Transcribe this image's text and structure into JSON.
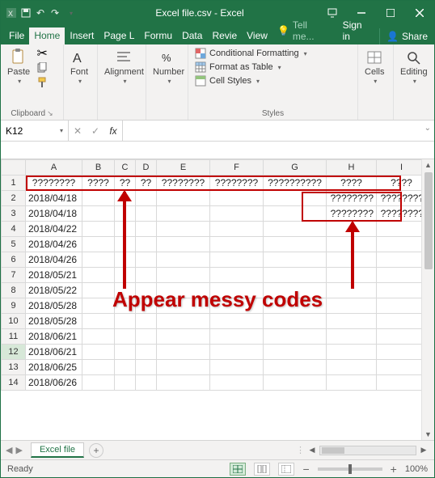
{
  "title": "Excel file.csv - Excel",
  "menu": {
    "file": "File",
    "home": "Home",
    "insert": "Insert",
    "page": "Page L",
    "formulas": "Formu",
    "data": "Data",
    "review": "Revie",
    "view": "View",
    "tell": "Tell me...",
    "signin": "Sign in",
    "share": "Share"
  },
  "ribbon": {
    "clipboard": {
      "paste": "Paste",
      "label": "Clipboard"
    },
    "font": {
      "btn": "Font",
      "label": ""
    },
    "alignment": {
      "btn": "Alignment",
      "label": ""
    },
    "number": {
      "btn": "Number",
      "label": ""
    },
    "styles": {
      "cond": "Conditional Formatting",
      "table": "Format as Table",
      "cell": "Cell Styles",
      "label": "Styles"
    },
    "cells": {
      "btn": "Cells",
      "label": ""
    },
    "editing": {
      "btn": "Editing",
      "label": ""
    }
  },
  "namebox": "K12",
  "columns": [
    "A",
    "B",
    "C",
    "D",
    "E",
    "F",
    "G",
    "H",
    "I"
  ],
  "rows": [
    {
      "n": 1,
      "A": "????????",
      "B": "????",
      "C": "??",
      "D": "??",
      "E": "????????",
      "F": "????????",
      "G": "??????????",
      "H": "????",
      "I": "????"
    },
    {
      "n": 2,
      "A": "2018/04/18",
      "H": "????????",
      "I": "????????"
    },
    {
      "n": 3,
      "A": "2018/04/18",
      "H": "????????",
      "I": "????????"
    },
    {
      "n": 4,
      "A": "2018/04/22"
    },
    {
      "n": 5,
      "A": "2018/04/26"
    },
    {
      "n": 6,
      "A": "2018/04/26"
    },
    {
      "n": 7,
      "A": "2018/05/21"
    },
    {
      "n": 8,
      "A": "2018/05/22"
    },
    {
      "n": 9,
      "A": "2018/05/28"
    },
    {
      "n": 10,
      "A": "2018/05/28"
    },
    {
      "n": 11,
      "A": "2018/06/21"
    },
    {
      "n": 12,
      "A": "2018/06/21",
      "sel": true
    },
    {
      "n": 13,
      "A": "2018/06/25"
    },
    {
      "n": 14,
      "A": "2018/06/26"
    }
  ],
  "sheet_tab": "Excel file",
  "status": {
    "ready": "Ready",
    "zoom": "100%"
  },
  "annotation": "Appear messy codes"
}
